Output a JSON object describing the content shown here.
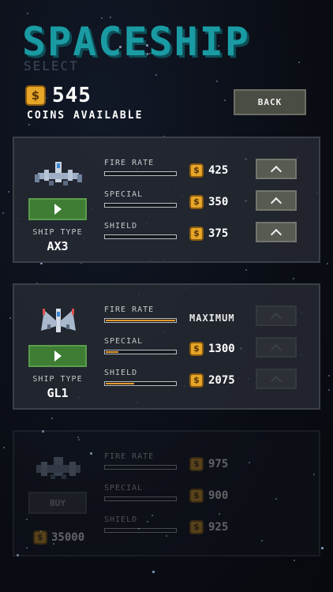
{
  "header": {
    "title": "SPACESHIP",
    "subtitle": "SELECT",
    "coins": "545",
    "coins_label": "COINS AVAILABLE",
    "back_label": "BACK"
  },
  "ship_type_label": "SHIP TYPE",
  "accent_colors": {
    "title": "#1a9ba3",
    "coin": "#e6a628",
    "play": "#3e7d33",
    "bar_fill": "#e59a2c"
  },
  "ships": [
    {
      "type": "AX3",
      "owned": true,
      "stats": [
        {
          "label": "FIRE RATE",
          "level": 0,
          "price": "425"
        },
        {
          "label": "SPECIAL",
          "level": 0,
          "price": "350"
        },
        {
          "label": "SHIELD",
          "level": 0,
          "price": "375"
        }
      ]
    },
    {
      "type": "GL1",
      "owned": true,
      "stats": [
        {
          "label": "FIRE RATE",
          "level": 1.0,
          "max_label": "MAXIMUM"
        },
        {
          "label": "SPECIAL",
          "level": 0.18,
          "price": "1300"
        },
        {
          "label": "SHIELD",
          "level": 0.41,
          "price": "2075"
        }
      ]
    },
    {
      "buy_label": "BUY",
      "price": "35000",
      "owned": false,
      "stats": [
        {
          "label": "FIRE RATE",
          "level": 0,
          "price": "975"
        },
        {
          "label": "SPECIAL",
          "level": 0,
          "price": "900"
        },
        {
          "label": "SHIELD",
          "level": 0,
          "price": "925"
        }
      ]
    }
  ],
  "icons": [
    "coin-icon",
    "play-icon",
    "chevron-up-icon",
    "ship-icon"
  ]
}
